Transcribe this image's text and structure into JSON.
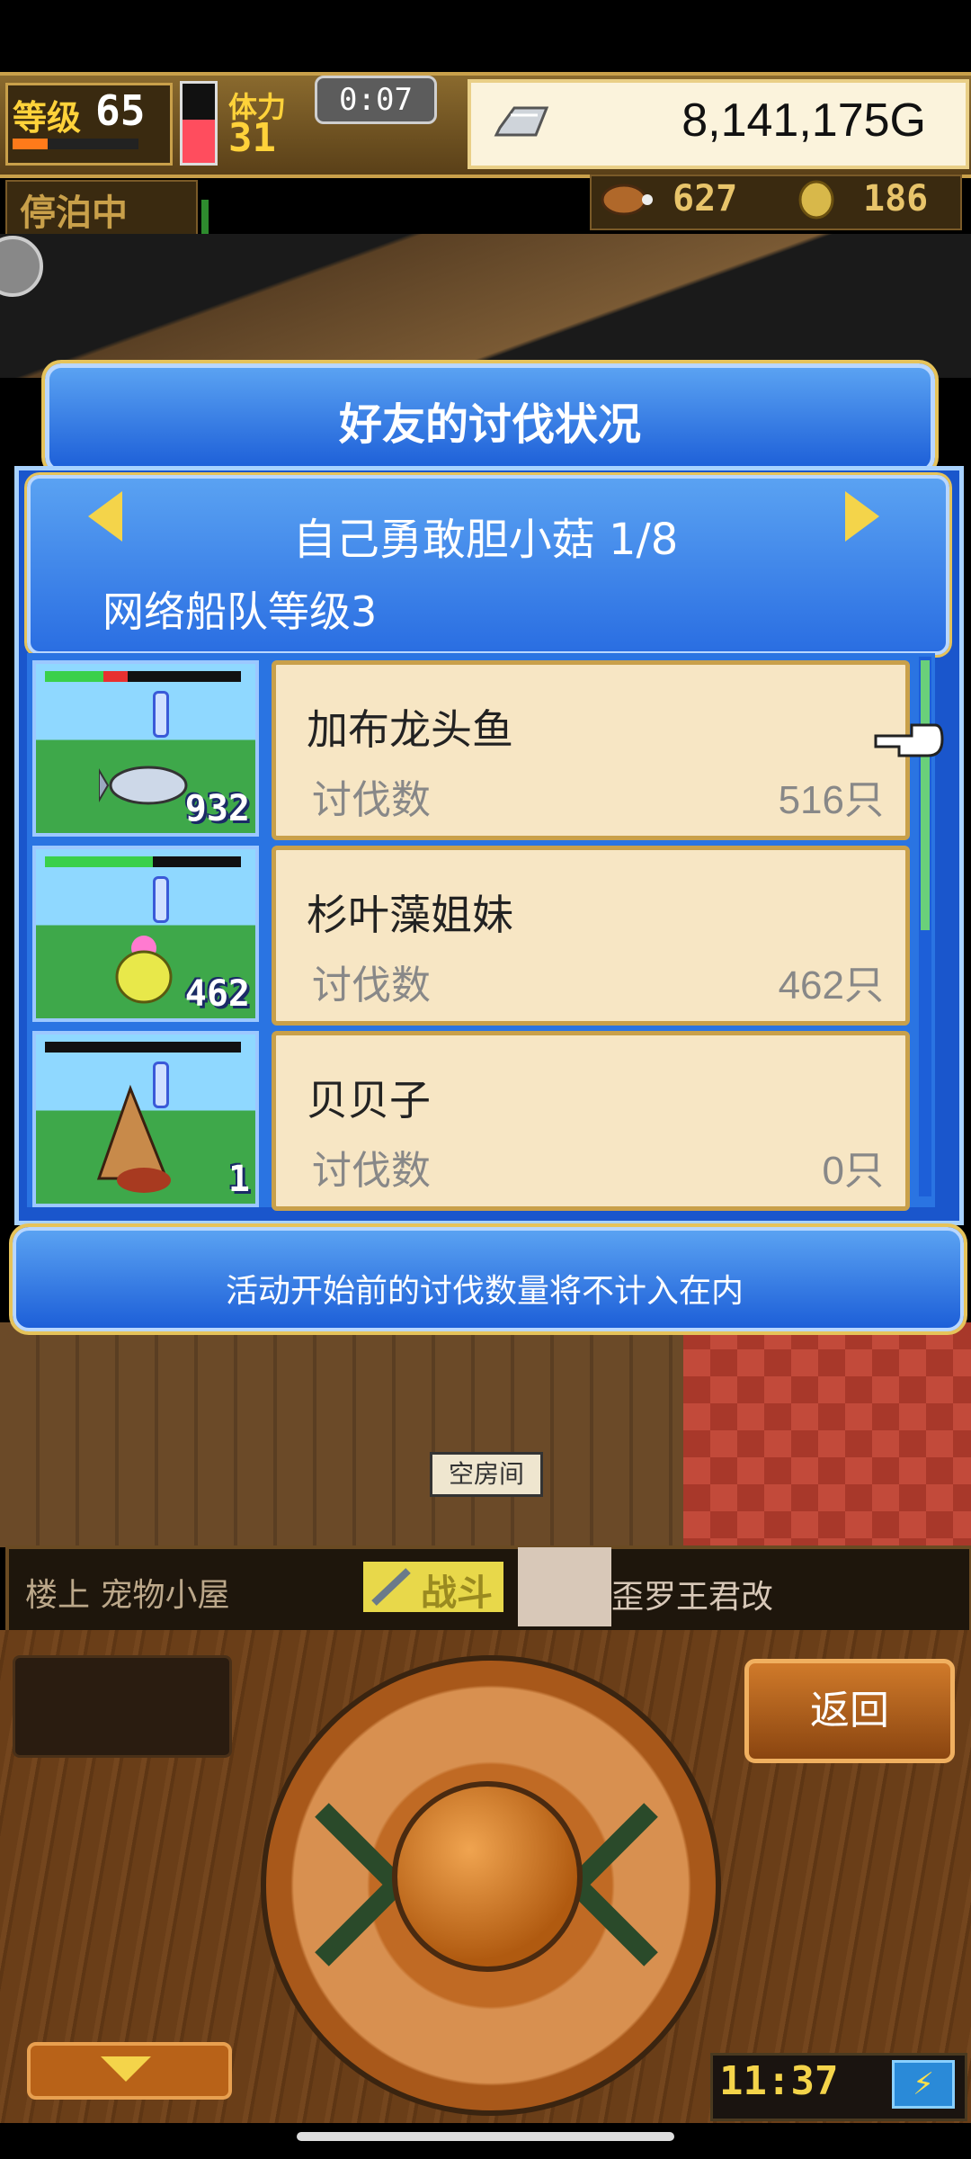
{
  "hud": {
    "level_label": "等级",
    "level_value": "65",
    "level_progress": 0.28,
    "stamina_label": "体力",
    "stamina_value": "31",
    "stamina_fill": 0.55,
    "timer": "0:07",
    "gold": "8,141,175G",
    "status": "停泊中",
    "resource_meat": "627",
    "resource_coin": "186"
  },
  "dialog": {
    "title": "好友的讨伐状况",
    "friend_name": "自己勇敢胆小菇 1/8",
    "fleet_level": "网络船队等级3",
    "rows": [
      {
        "name": "加布龙头鱼",
        "kill_label": "讨伐数",
        "kill_value": "516只",
        "count": "932",
        "hp_fraction": 0.3,
        "hp_red_fraction": 0.12
      },
      {
        "name": "杉叶藻姐妹",
        "kill_label": "讨伐数",
        "kill_value": "462只",
        "count": "462",
        "hp_fraction": 0.55,
        "hp_red_fraction": 0
      },
      {
        "name": "贝贝子",
        "kill_label": "讨伐数",
        "kill_value": "0只",
        "count": "1",
        "hp_fraction": 0,
        "hp_red_fraction": 0
      }
    ],
    "notice": "活动开始前的讨伐数量将不计入在内"
  },
  "world": {
    "room_label": "空房间"
  },
  "bottom": {
    "location": "楼上 宠物小屋",
    "battle": "战斗",
    "boss_name": "歪罗王君改",
    "back": "返回",
    "clock": "11:37"
  },
  "colors": {
    "dialog_blue": "#1d5fd8",
    "card_bg": "#f7e6c4",
    "gold_trim": "#e6c35a",
    "hp_green": "#3ad04a"
  }
}
